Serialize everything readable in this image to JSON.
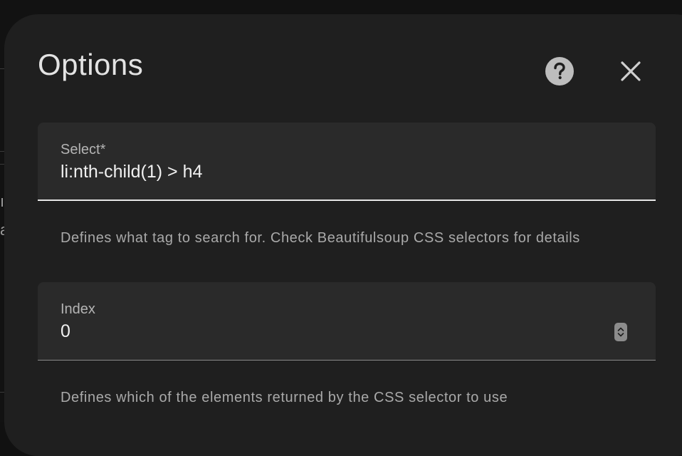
{
  "dialog": {
    "title": "Options",
    "help_icon": "help-circle-icon",
    "close_icon": "close-icon"
  },
  "fields": {
    "select": {
      "label": "Select*",
      "value": "li:nth-child(1) > h4",
      "helper": "Defines what tag to search for. Check Beautifulsoup CSS selectors for details"
    },
    "index": {
      "label": "Index",
      "value": "0",
      "helper": "Defines which of the elements returned by the CSS selector to use"
    }
  },
  "background": {
    "partial_glyphs": [
      "ı",
      "a"
    ]
  },
  "colors": {
    "dialog_bg": "#1f1f1f",
    "field_bg": "#2a2a2a",
    "text_primary": "#f0f0f0",
    "text_secondary": "#a9a9a9"
  }
}
